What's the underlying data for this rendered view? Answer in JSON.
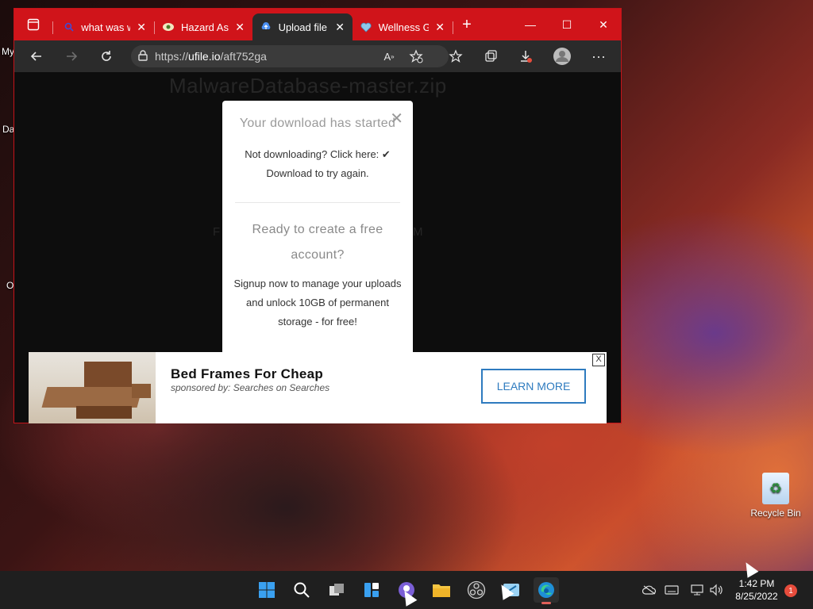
{
  "desktop": {
    "fragments": [
      "My",
      "Da",
      "O"
    ],
    "recycle_bin_label": "Recycle Bin"
  },
  "browser": {
    "tabs": [
      {
        "title": "what was w",
        "icon": "search-icon",
        "active": false
      },
      {
        "title": "Hazard Ass",
        "icon": "hazard-favicon-icon",
        "active": false
      },
      {
        "title": "Upload file",
        "icon": "upload-favicon-icon",
        "active": true
      },
      {
        "title": "Wellness G",
        "icon": "heart-favicon-icon",
        "active": false
      }
    ],
    "new_tab_symbol": "+",
    "window_controls": {
      "minimize": "—",
      "maximize": "☐",
      "close": "✕"
    },
    "address": {
      "prefix": "https://",
      "host": "ufile.io",
      "path": "/aft752ga"
    }
  },
  "page": {
    "background_title": "MalwareDatabase-master.zip",
    "background_left_fragment": "F",
    "background_right_fragment": "M",
    "modal": {
      "title": "Your download has started",
      "line1": "Not downloading? Click here: ✔",
      "line2": "Download to try again.",
      "heading2_line1": "Ready to create a free",
      "heading2_line2": "account?",
      "body_line1": "Signup now to manage your uploads",
      "body_line2": "and unlock 10GB of permanent",
      "body_line3": "storage - for free!"
    }
  },
  "ad": {
    "title": "Bed Frames For Cheap",
    "sponsor": "sponsored by: Searches on Searches",
    "cta": "LEARN MORE",
    "close": "X"
  },
  "taskbar": {
    "time": "1:42 PM",
    "date": "8/25/2022",
    "notification_count": "1"
  },
  "colors": {
    "edge_accent": "#d0141a",
    "cta_blue": "#2e7bbf",
    "taskbar": "#1f1f1f"
  }
}
